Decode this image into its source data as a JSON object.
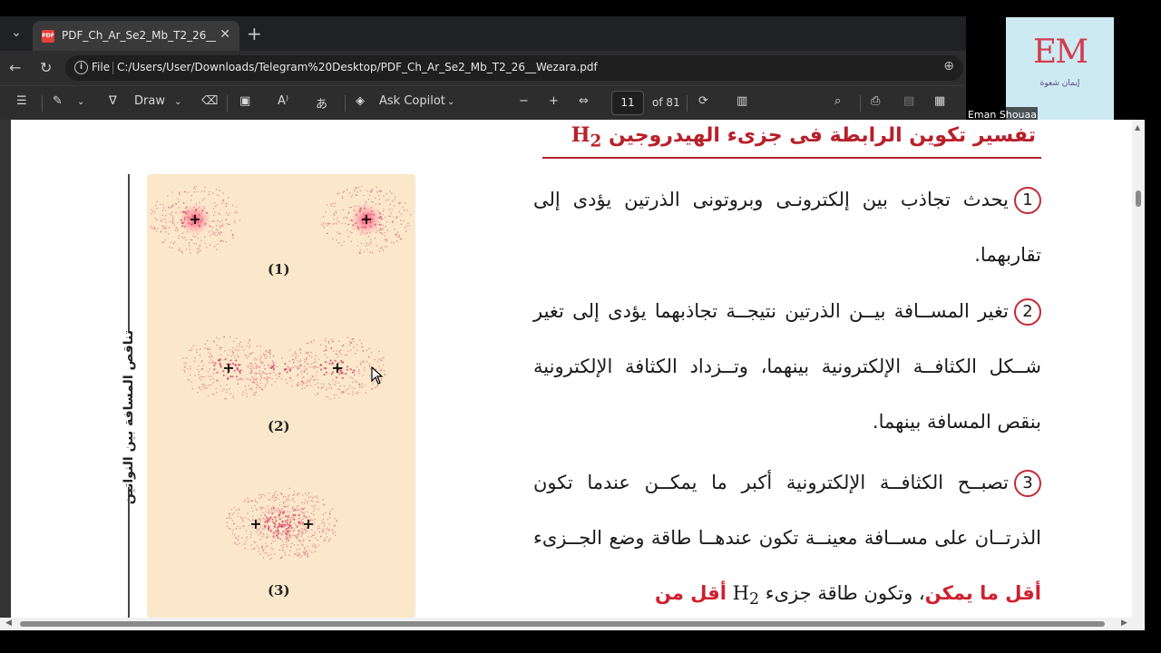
{
  "browser": {
    "tab_title": "PDF_Ch_Ar_Se2_Mb_T2_26__Wezara.pdf",
    "pdf_badge": "PDF",
    "url_label": "File",
    "url": "C:/Users/User/Downloads/Telegram%20Desktop/PDF_Ch_Ar_Se2_Mb_T2_26__Wezara.pdf"
  },
  "toolbar": {
    "draw_label": "Draw",
    "copilot_label": "Ask Copilot",
    "page_number": "11",
    "page_total": "of 81"
  },
  "webcam": {
    "logo": "EM",
    "logo_sub": "إيمان شعوة",
    "name": "Eman Shouaa"
  },
  "document": {
    "heading": "تفسير تكوين الرابطة فى جزىء الهيدروجين",
    "heading_symbol": "H",
    "heading_subscript": "2",
    "items": [
      {
        "number": "1",
        "text": "يحدث تجاذب بين إلكترونـى وبروتونى الذرتين يؤدى إلى تقاربهما."
      },
      {
        "number": "2",
        "text": "تغير المســافة بيــن الذرتين نتيجــة تجاذبهما يؤدى إلى تغير شــكل الكثافــة الإلكترونية بينهما، وتــزداد الكثافة الإلكترونية بنقص المسافة بينهما."
      },
      {
        "number": "3",
        "text_a": "تصبــح الكثافــة الإلكترونية أكبر ما يمكــن عندما تكون الذرتــان على مســافة معينــة تكون عندهــا طاقة وضع الجــزىء",
        "red_a": "أقل ما يمكن",
        "text_b": "، وتكون طاقة جزىء",
        "symbol": "H",
        "subscript": "2",
        "red_b": "أقل من"
      }
    ],
    "diagram": {
      "axis_label": "تناقص المسافة بين النواتين",
      "label_1": "(1)",
      "label_2": "(2)",
      "label_3": "(3)",
      "nucleus_sign": "+"
    }
  }
}
